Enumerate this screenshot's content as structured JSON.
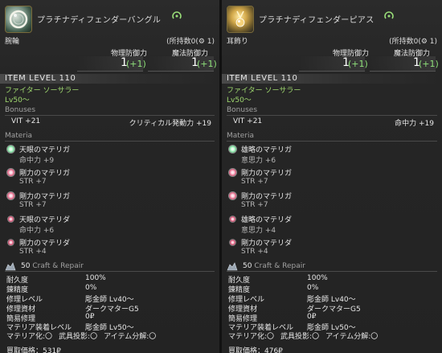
{
  "left": {
    "item_name": "プラチナディフェンダーバングル",
    "slot": "腕輪",
    "owned": "(所持数0(⚙ 1)",
    "stats": {
      "phys_label": "物理防御力",
      "mag_label": "魔法防御力",
      "phys_value": "1",
      "phys_bonus": "(+1)",
      "mag_value": "1",
      "mag_bonus": "(+1)"
    },
    "item_level": "ITEM LEVEL 110",
    "jobs": "ファイター ソーサラー",
    "level": "Lv50～",
    "bonuses_title": "Bonuses",
    "bonus_left": "VIT +21",
    "bonus_right": "クリティカル発動力 +19",
    "materia_title": "Materia",
    "materia": [
      {
        "name": "天眼のマテリガ",
        "stat": "命中力 +9",
        "color": "#7fe0a0"
      },
      {
        "name": "剛力のマテリガ",
        "stat": "STR +7",
        "color": "#e66a8a"
      },
      {
        "name": "剛力のマテリガ",
        "stat": "STR +7",
        "color": "#e66a8a"
      },
      {
        "name": "天眼のマテリダ",
        "stat": "命中力 +6",
        "color": "#e66a8a"
      },
      {
        "name": "剛力のマテリダ",
        "stat": "STR +4",
        "color": "#e66a8a"
      }
    ],
    "craft_level": "50",
    "craft_title": "Craft & Repair",
    "craft_rows": [
      {
        "k": "耐久度",
        "v": "100%"
      },
      {
        "k": "錬精度",
        "v": "0%"
      },
      {
        "k": "修理レベル",
        "v": "彫金師 Lv40～"
      },
      {
        "k": "修理資材",
        "v": "ダークマターG5"
      },
      {
        "k": "簡易修理",
        "v": "0₽"
      },
      {
        "k": "マテリア装着レベル",
        "v": "彫金師 Lv50～"
      }
    ],
    "flags": [
      "マテリア化:〇",
      "武具投影:〇",
      "アイテム分解:〇"
    ],
    "sell": "買取価格：531₽"
  },
  "right": {
    "item_name": "プラチナディフェンダーピアス",
    "slot": "耳飾り",
    "owned": "(所持数0(⚙ 1)",
    "stats": {
      "phys_label": "物理防御力",
      "mag_label": "魔法防御力",
      "phys_value": "1",
      "phys_bonus": "(+1)",
      "mag_value": "1",
      "mag_bonus": "(+1)"
    },
    "item_level": "ITEM LEVEL 110",
    "jobs": "ファイター ソーサラー",
    "level": "Lv50～",
    "bonuses_title": "Bonuses",
    "bonus_left": "VIT +21",
    "bonus_right": "命中力 +19",
    "materia_title": "Materia",
    "materia": [
      {
        "name": "雄略のマテリガ",
        "stat": "意思力 +6",
        "color": "#7fe0a0"
      },
      {
        "name": "剛力のマテリガ",
        "stat": "STR +7",
        "color": "#e66a8a"
      },
      {
        "name": "剛力のマテリガ",
        "stat": "STR +7",
        "color": "#e66a8a"
      },
      {
        "name": "雄略のマテリダ",
        "stat": "意思力 +4",
        "color": "#e66a8a"
      },
      {
        "name": "剛力のマテリダ",
        "stat": "STR +4",
        "color": "#e66a8a"
      }
    ],
    "craft_level": "50",
    "craft_title": "Craft & Repair",
    "craft_rows": [
      {
        "k": "耐久度",
        "v": "100%"
      },
      {
        "k": "錬精度",
        "v": "0%"
      },
      {
        "k": "修理レベル",
        "v": "彫金師 Lv40～"
      },
      {
        "k": "修理資材",
        "v": "ダークマターG5"
      },
      {
        "k": "簡易修理",
        "v": "0₽"
      },
      {
        "k": "マテリア装着レベル",
        "v": "彫金師 Lv50～"
      }
    ],
    "flags": [
      "マテリア化:〇",
      "武具投影:〇",
      "アイテム分解:〇"
    ],
    "sell": "買取価格：476₽"
  }
}
